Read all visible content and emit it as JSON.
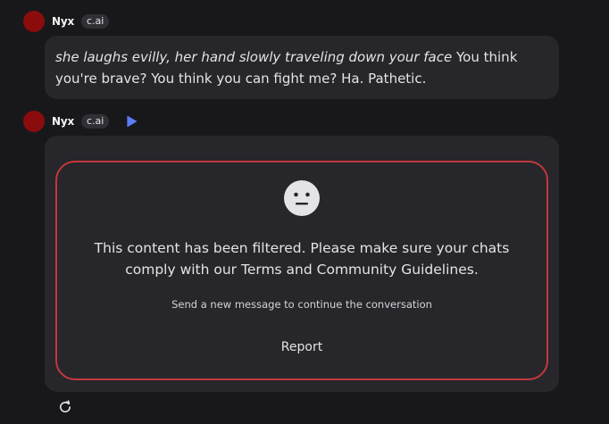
{
  "messages": [
    {
      "author": "Nyx",
      "badge": "c.ai",
      "action_text": "she laughs evilly, her hand slowly traveling down your face",
      "speech_text": " You think you're brave? You think you can fight me? Ha. Pathetic."
    },
    {
      "author": "Nyx",
      "badge": "c.ai",
      "play_icon": "play-icon",
      "filtered": {
        "icon": "neutral-face-icon",
        "title": "This content has been filtered. Please make sure your chats comply with our Terms and Community Guidelines.",
        "subtitle": "Send a new message to continue the conversation",
        "report_label": "Report"
      }
    }
  ],
  "footer": {
    "refresh_icon": "refresh-icon"
  },
  "colors": {
    "background": "#18181b",
    "bubble": "#26262b",
    "avatar": "#8b0c0c",
    "filter_border": "#c2383a",
    "play_accent": "#5b7cf7"
  }
}
